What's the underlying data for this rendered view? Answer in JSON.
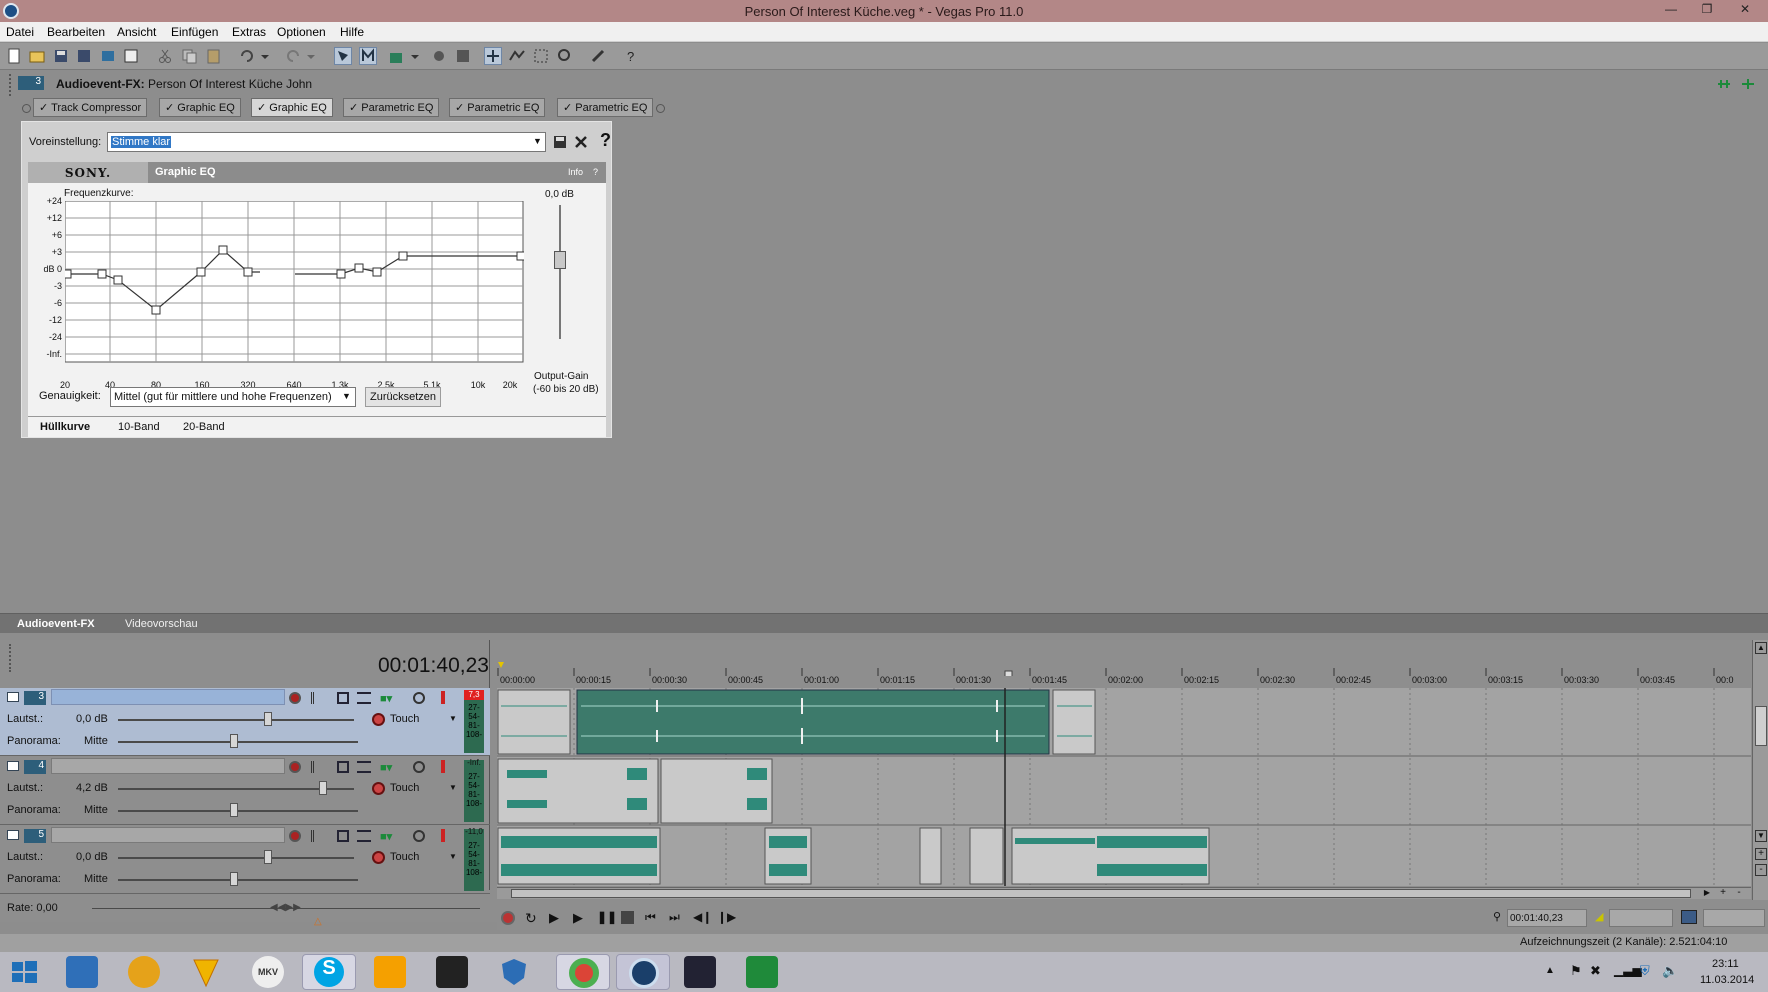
{
  "window": {
    "title": "Person Of Interest Küche.veg * - Vegas Pro 11.0"
  },
  "menu": [
    "Datei",
    "Bearbeiten",
    "Ansicht",
    "Einfügen",
    "Extras",
    "Optionen",
    "Hilfe"
  ],
  "fx_window": {
    "track_number": "3",
    "title_prefix": "Audioevent-FX:",
    "title_name": "Person Of Interest Küche John",
    "chain": [
      "Track Compressor",
      "Graphic EQ",
      "Graphic EQ",
      "Parametric EQ",
      "Parametric EQ",
      "Parametric EQ"
    ],
    "preset_label": "Voreinstellung:",
    "preset_value": "Stimme klar",
    "help_glyph": "?"
  },
  "plugin": {
    "brand": "SONY.",
    "name": "Graphic EQ",
    "info": "Info",
    "info_help": "?",
    "curve_label": "Frequenzkurve:",
    "y_labels": [
      "+24",
      "+12",
      "+6",
      "+3",
      "dB 0",
      "-3",
      "-6",
      "-12",
      "-24",
      "-Inf."
    ],
    "x_labels": [
      "20",
      "40",
      "80",
      "160",
      "320",
      "640",
      "1.3k",
      "2.5k",
      "5.1k",
      "10k",
      "20k"
    ],
    "gain_value": "0,0 dB",
    "gain_label": "Output-Gain",
    "gain_range": "(-60 bis 20 dB)",
    "accuracy_label": "Genauigkeit:",
    "accuracy_value": "Mittel (gut für mittlere und hohe Frequenzen)",
    "reset_button": "Zurücksetzen",
    "tabs": [
      "Hüllkurve",
      "10-Band",
      "20-Band"
    ]
  },
  "lower_tabs": [
    "Audioevent-FX",
    "Videovorschau"
  ],
  "timecode": "00:01:40,23",
  "ruler": [
    "00:00:00",
    "00:00:15",
    "00:00:30",
    "00:00:45",
    "00:01:00",
    "00:01:15",
    "00:01:30",
    "00:01:45",
    "00:02:00",
    "00:02:15",
    "00:02:30",
    "00:02:45",
    "00:03:00",
    "00:03:15",
    "00:03:30",
    "00:03:45",
    "00:0"
  ],
  "tracks": [
    {
      "num": "3",
      "vol_label": "Lautst.:",
      "vol_value": "0,0 dB",
      "pan_label": "Panorama:",
      "pan_value": "Mitte",
      "mode": "Touch",
      "peak": "7,3",
      "meter": "27-\n54-\n81-\n108-"
    },
    {
      "num": "4",
      "vol_label": "Lautst.:",
      "vol_value": "4,2 dB",
      "pan_label": "Panorama:",
      "pan_value": "Mitte",
      "mode": "Touch",
      "peak": "-Inf.",
      "meter": "27-\n54-\n81-\n108-"
    },
    {
      "num": "5",
      "vol_label": "Lautst.:",
      "vol_value": "0,0 dB",
      "pan_label": "Panorama:",
      "pan_value": "Mitte",
      "mode": "Touch",
      "peak": "-11,0",
      "meter": "27-\n54-\n81-\n108-"
    }
  ],
  "rate": "Rate: 0,00",
  "transport_time": "00:01:40,23",
  "status_text": "Aufzeichnungszeit (2 Kanäle): 2.521:04:10",
  "clock": {
    "time": "23:11",
    "date": "11.03.2014"
  },
  "taskbar_apps": [
    "windows-start",
    "network-app",
    "audacity",
    "vlc",
    "mkv",
    "skype",
    "media",
    "blackberry",
    "shield",
    "chrome",
    "vegas",
    "fan-app",
    "excel"
  ]
}
